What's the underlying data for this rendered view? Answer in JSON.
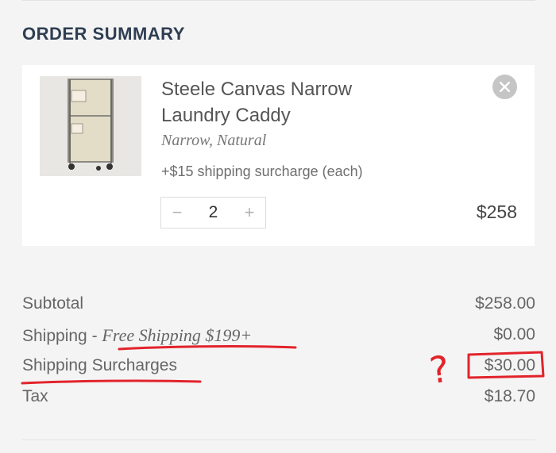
{
  "header": {
    "title": "ORDER SUMMARY"
  },
  "item": {
    "image_icon": "laundry-caddy-photo",
    "name": "Steele Canvas Narrow Laundry Caddy",
    "variant": "Narrow, Natural",
    "surcharge_note": "+$15 shipping surcharge (each)",
    "quantity": "2",
    "minus_label": "−",
    "plus_label": "+",
    "price": "$258",
    "remove_icon": "close-icon"
  },
  "totals": {
    "subtotal_label": "Subtotal",
    "subtotal_value": "$258.00",
    "shipping_label": "Shipping - ",
    "shipping_promo": "Free Shipping $199+",
    "shipping_value": "$0.00",
    "surcharges_label": "Shipping Surcharges",
    "surcharges_value": "$30.00",
    "tax_label": "Tax",
    "tax_value": "$18.70"
  },
  "annotation": {
    "mark": "?",
    "color": "#e2232b"
  },
  "colors": {
    "title": "#2f3e52",
    "background": "#f4f4f4",
    "card": "#ffffff"
  }
}
